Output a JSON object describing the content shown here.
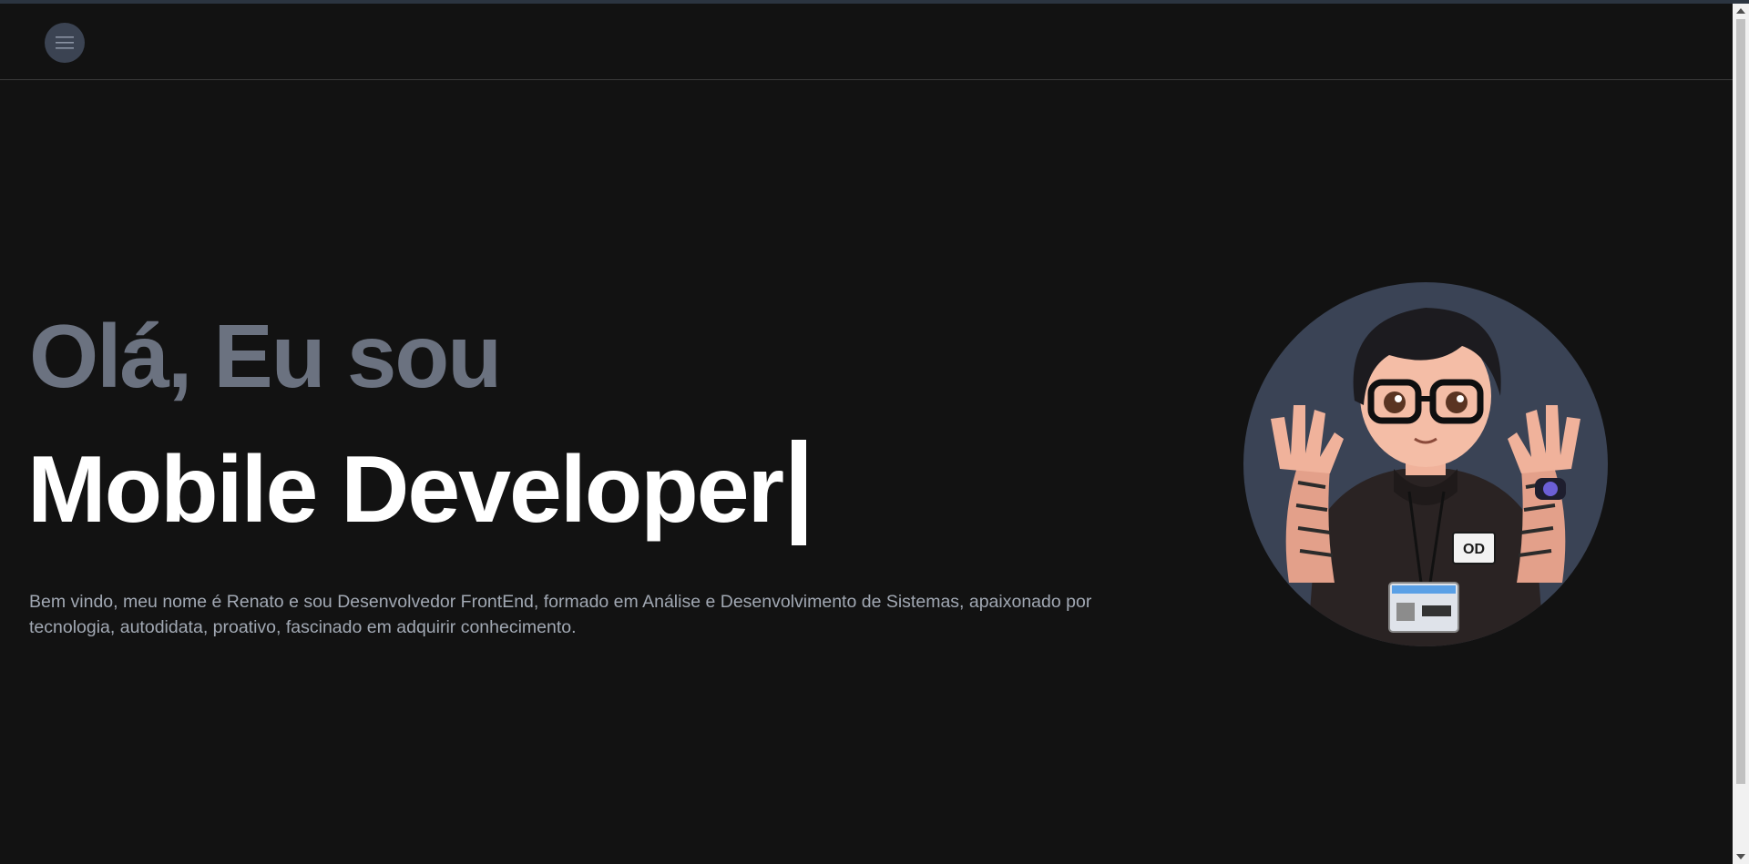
{
  "navbar": {
    "menu_icon": "hamburger-menu-icon"
  },
  "hero": {
    "greeting": "Olá, Eu sou",
    "role": "Mobile Developer",
    "bio": "Bem vindo, meu nome é Renato e sou Desenvolvedor FrontEnd, formado em Análise e Desenvolvimento de Sistemas, apaixonado por tecnologia, autodidata, proativo, fascinado em adquirir conhecimento.",
    "avatar_badge": "OD"
  },
  "colors": {
    "background": "#121212",
    "greeting": "#6b7280",
    "role": "#ffffff",
    "bio": "#a1a8b3",
    "avatar_bg": "#3a4355"
  }
}
